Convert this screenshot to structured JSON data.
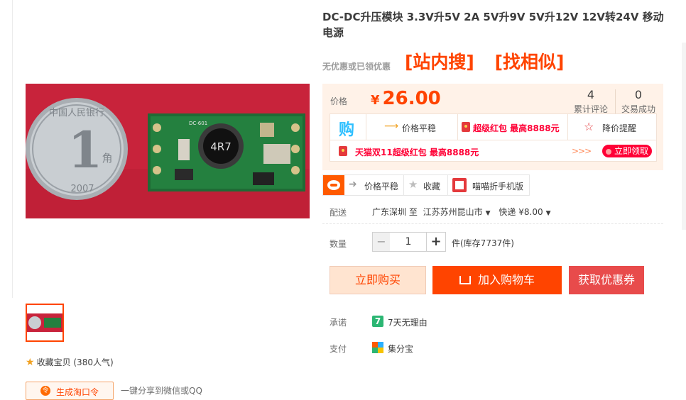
{
  "product": {
    "title": "DC-DC升压模块 3.3V升5V 2A 5V升9V 5V升12V 12V转24V 移动电源",
    "no_coupon_text": "无优惠或已领优惠",
    "promo_links": [
      "[站内搜]",
      "[找相似]"
    ]
  },
  "left": {
    "coin_number": "1",
    "coin_unit": "角",
    "coin_year": "2007",
    "coin_text": "中国人民银行",
    "board_label": "4R7",
    "board_silk": "DC-601",
    "favorite_text": "收藏宝贝 (380人气)",
    "share_button_label": "生成淘口令",
    "share_text": "一键分享到微信或QQ"
  },
  "price": {
    "label": "价格",
    "currency": "¥",
    "value": "26.00",
    "reviews_count": "4",
    "reviews_label": "累计评论",
    "sales_count": "0",
    "sales_label": "交易成功"
  },
  "promo_box": {
    "gou_icon": "购",
    "steady_label": "价格平稳",
    "red_packet_label": "超级红包 最高8888元",
    "price_alert_label": "降价提醒",
    "double11_label": "天猫双11超级红包 最高8888元",
    "chevrons": ">>>",
    "claim_label": "立即领取"
  },
  "tools": {
    "steady_label": "价格平稳",
    "fav_label": "收藏",
    "mobile_label": "喵喵折手机版"
  },
  "delivery": {
    "label": "配送",
    "from": "广东深圳 至",
    "to": "江苏苏州昆山市",
    "shipping": "快递 ¥8.00"
  },
  "quantity": {
    "label": "数量",
    "minus": "−",
    "value": "1",
    "plus": "+",
    "stock": "件(库存7737件)"
  },
  "buttons": {
    "buy_now": "立即购买",
    "add_to_cart": "加入购物车",
    "get_coupon": "获取优惠券"
  },
  "promise": {
    "label": "承诺",
    "icon_text": "7",
    "text": "7天无理由"
  },
  "payment": {
    "label": "支付",
    "text": "集分宝"
  },
  "colors": {
    "accent": "#ff4400",
    "price_bg": "#fff2e8",
    "claim_red": "#ff0036",
    "coupon_button": "#e84b4b",
    "buy_now_bg": "#ffe4d0"
  }
}
